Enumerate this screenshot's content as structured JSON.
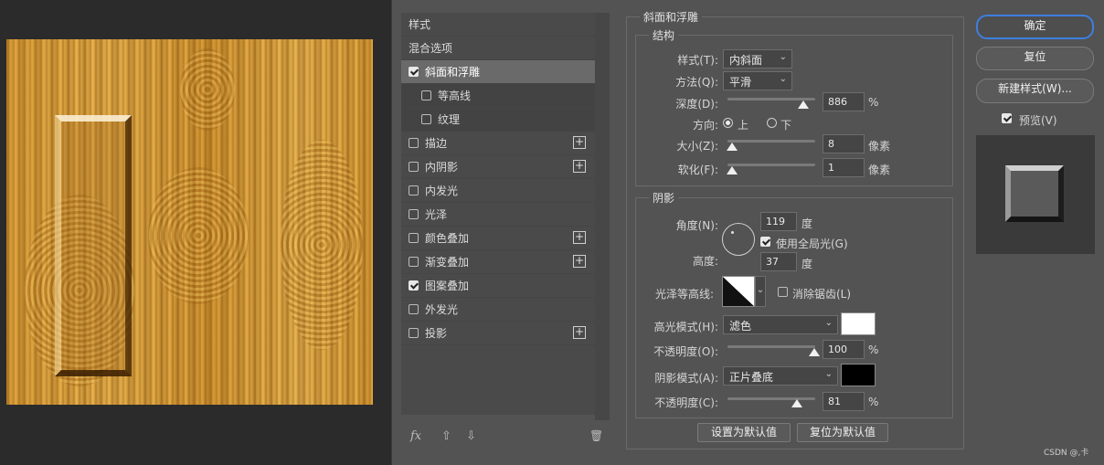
{
  "styles_panel": {
    "header": "样式",
    "blending_options": "混合选项",
    "items": [
      {
        "label": "斜面和浮雕",
        "checked": true,
        "selected": true,
        "has_plus": false
      },
      {
        "label": "等高线",
        "checked": false,
        "sub": true,
        "has_plus": false
      },
      {
        "label": "纹理",
        "checked": false,
        "sub": true,
        "has_plus": false
      },
      {
        "label": "描边",
        "checked": false,
        "has_plus": true
      },
      {
        "label": "内阴影",
        "checked": false,
        "has_plus": true
      },
      {
        "label": "内发光",
        "checked": false,
        "has_plus": false
      },
      {
        "label": "光泽",
        "checked": false,
        "has_plus": false
      },
      {
        "label": "颜色叠加",
        "checked": false,
        "has_plus": true
      },
      {
        "label": "渐变叠加",
        "checked": false,
        "has_plus": true
      },
      {
        "label": "图案叠加",
        "checked": true,
        "has_plus": false
      },
      {
        "label": "外发光",
        "checked": false,
        "has_plus": false
      },
      {
        "label": "投影",
        "checked": false,
        "has_plus": true
      }
    ],
    "footer": {
      "fx": "fx",
      "up": "⇧",
      "down": "⇩",
      "trash": "🗑"
    }
  },
  "bevel": {
    "title": "斜面和浮雕",
    "structure": {
      "title": "结构",
      "style_label": "样式(T):",
      "style_value": "内斜面",
      "technique_label": "方法(Q):",
      "technique_value": "平滑",
      "depth_label": "深度(D):",
      "depth_value": "886",
      "depth_unit": "%",
      "direction_label": "方向:",
      "direction_up": "上",
      "direction_down": "下",
      "size_label": "大小(Z):",
      "size_value": "8",
      "size_unit": "像素",
      "soften_label": "软化(F):",
      "soften_value": "1",
      "soften_unit": "像素"
    },
    "shading": {
      "title": "阴影",
      "angle_label": "角度(N):",
      "angle_value": "119",
      "angle_unit": "度",
      "global_light_label": "使用全局光(G)",
      "altitude_label": "高度:",
      "altitude_value": "37",
      "altitude_unit": "度",
      "gloss_contour_label": "光泽等高线:",
      "anti_alias_label": "消除锯齿(L)",
      "highlight_mode_label": "高光模式(H):",
      "highlight_mode_value": "滤色",
      "highlight_color": "#ffffff",
      "highlight_opacity_label": "不透明度(O):",
      "highlight_opacity_value": "100",
      "shadow_mode_label": "阴影模式(A):",
      "shadow_mode_value": "正片叠底",
      "shadow_color": "#000000",
      "shadow_opacity_label": "不透明度(C):",
      "shadow_opacity_value": "81",
      "percent": "%"
    },
    "make_default": "设置为默认值",
    "reset_default": "复位为默认值"
  },
  "buttons": {
    "ok": "确定",
    "reset": "复位",
    "new_style": "新建样式(W)...",
    "preview_label": "预览(V)"
  },
  "watermark": "CSDN @,卡",
  "colors": {
    "accent": "#3d7fe0",
    "panel": "#535353"
  }
}
